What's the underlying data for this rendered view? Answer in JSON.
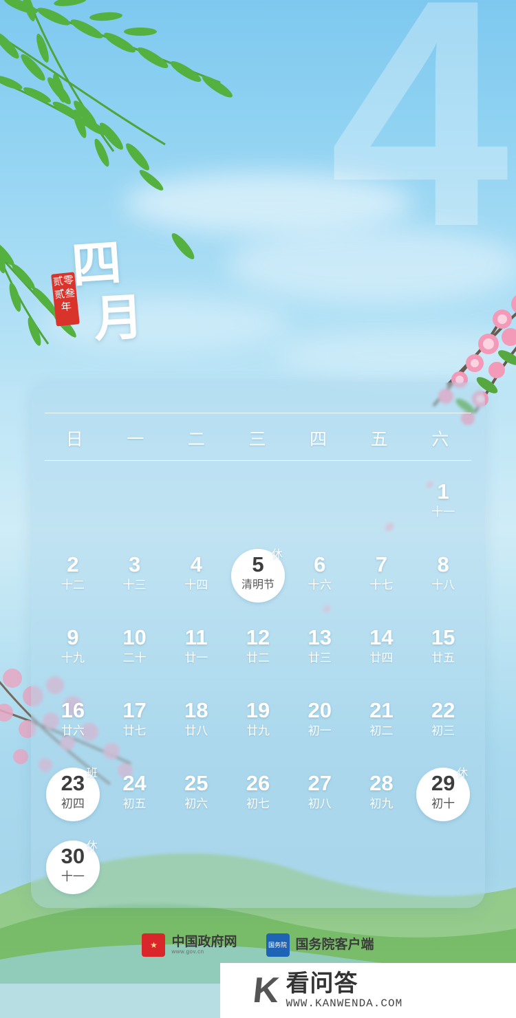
{
  "poster": {
    "month_big_number": "4",
    "title_chars": [
      "四",
      "月"
    ],
    "seal_text": "贰零贰叁年"
  },
  "calendar": {
    "weekday_headers": [
      "日",
      "一",
      "二",
      "三",
      "四",
      "五",
      "六"
    ],
    "lead_blanks": 6,
    "days": [
      {
        "num": "1",
        "lunar": "十一",
        "tag": "",
        "highlight": false
      },
      {
        "num": "2",
        "lunar": "十二",
        "tag": "",
        "highlight": false
      },
      {
        "num": "3",
        "lunar": "十三",
        "tag": "",
        "highlight": false
      },
      {
        "num": "4",
        "lunar": "十四",
        "tag": "",
        "highlight": false
      },
      {
        "num": "5",
        "lunar": "清明节",
        "tag": "休",
        "highlight": true
      },
      {
        "num": "6",
        "lunar": "十六",
        "tag": "",
        "highlight": false
      },
      {
        "num": "7",
        "lunar": "十七",
        "tag": "",
        "highlight": false
      },
      {
        "num": "8",
        "lunar": "十八",
        "tag": "",
        "highlight": false
      },
      {
        "num": "9",
        "lunar": "十九",
        "tag": "",
        "highlight": false
      },
      {
        "num": "10",
        "lunar": "二十",
        "tag": "",
        "highlight": false
      },
      {
        "num": "11",
        "lunar": "廿一",
        "tag": "",
        "highlight": false
      },
      {
        "num": "12",
        "lunar": "廿二",
        "tag": "",
        "highlight": false
      },
      {
        "num": "13",
        "lunar": "廿三",
        "tag": "",
        "highlight": false
      },
      {
        "num": "14",
        "lunar": "廿四",
        "tag": "",
        "highlight": false
      },
      {
        "num": "15",
        "lunar": "廿五",
        "tag": "",
        "highlight": false
      },
      {
        "num": "16",
        "lunar": "廿六",
        "tag": "",
        "highlight": false
      },
      {
        "num": "17",
        "lunar": "廿七",
        "tag": "",
        "highlight": false
      },
      {
        "num": "18",
        "lunar": "廿八",
        "tag": "",
        "highlight": false
      },
      {
        "num": "19",
        "lunar": "廿九",
        "tag": "",
        "highlight": false
      },
      {
        "num": "20",
        "lunar": "初一",
        "tag": "",
        "highlight": false
      },
      {
        "num": "21",
        "lunar": "初二",
        "tag": "",
        "highlight": false
      },
      {
        "num": "22",
        "lunar": "初三",
        "tag": "",
        "highlight": false
      },
      {
        "num": "23",
        "lunar": "初四",
        "tag": "班",
        "highlight": true
      },
      {
        "num": "24",
        "lunar": "初五",
        "tag": "",
        "highlight": false
      },
      {
        "num": "25",
        "lunar": "初六",
        "tag": "",
        "highlight": false
      },
      {
        "num": "26",
        "lunar": "初七",
        "tag": "",
        "highlight": false
      },
      {
        "num": "27",
        "lunar": "初八",
        "tag": "",
        "highlight": false
      },
      {
        "num": "28",
        "lunar": "初九",
        "tag": "",
        "highlight": false
      },
      {
        "num": "29",
        "lunar": "初十",
        "tag": "休",
        "highlight": true
      },
      {
        "num": "30",
        "lunar": "十一",
        "tag": "休",
        "highlight": true
      }
    ]
  },
  "footer": {
    "logos": [
      {
        "emblem": "★",
        "name": "中国政府网",
        "url": "www.gov.cn"
      },
      {
        "emblem": "国务院",
        "name": "国务院客户端",
        "url": ""
      }
    ]
  },
  "watermark": {
    "mark": "K",
    "name": "看问答",
    "url": "WWW.KANWENDA.COM"
  }
}
